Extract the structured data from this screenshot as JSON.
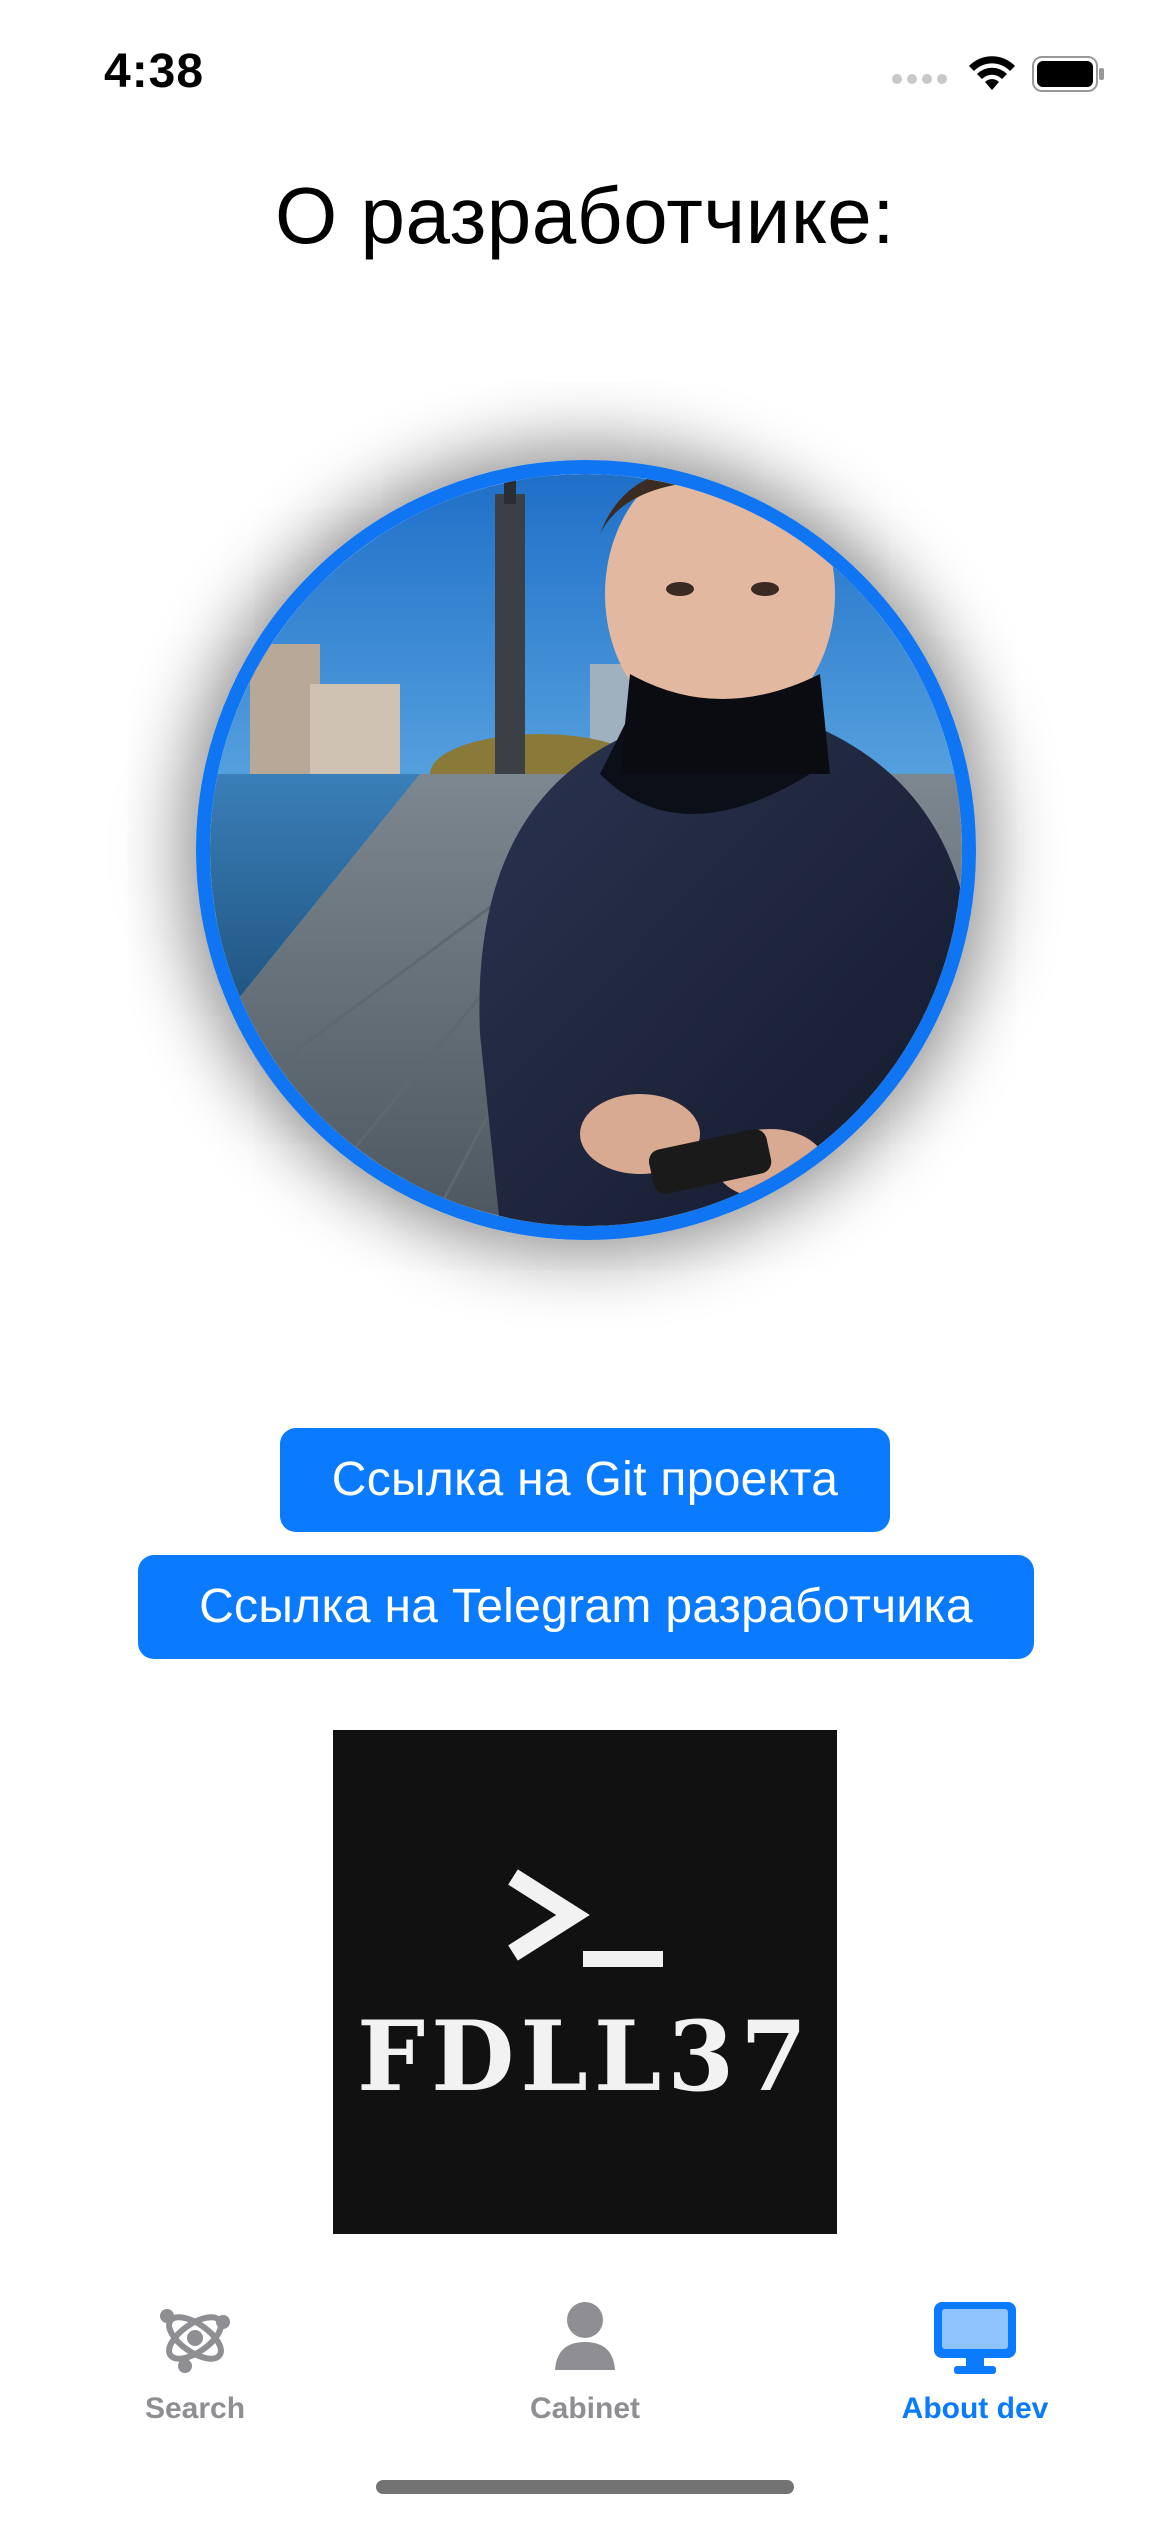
{
  "status_bar": {
    "time": "4:38"
  },
  "page": {
    "title": "О разработчике:"
  },
  "buttons": {
    "git_label": "Ссылка на Git проекта",
    "telegram_label": "Ссылка на Telegram разработчика"
  },
  "logo": {
    "text": "FDLL37",
    "prompt_symbol": ">_"
  },
  "tabbar": {
    "active_color": "#0a7aff",
    "inactive_color": "#8e8e93",
    "tabs": [
      {
        "label": "Search",
        "icon": "molecule-icon",
        "active": false
      },
      {
        "label": "Cabinet",
        "icon": "person-icon",
        "active": false
      },
      {
        "label": "About dev",
        "icon": "desktop-computer-icon",
        "active": true
      }
    ]
  },
  "colors": {
    "accent": "#0a7aff",
    "avatar_border": "#0f75f2",
    "logo_bg": "#111111"
  }
}
